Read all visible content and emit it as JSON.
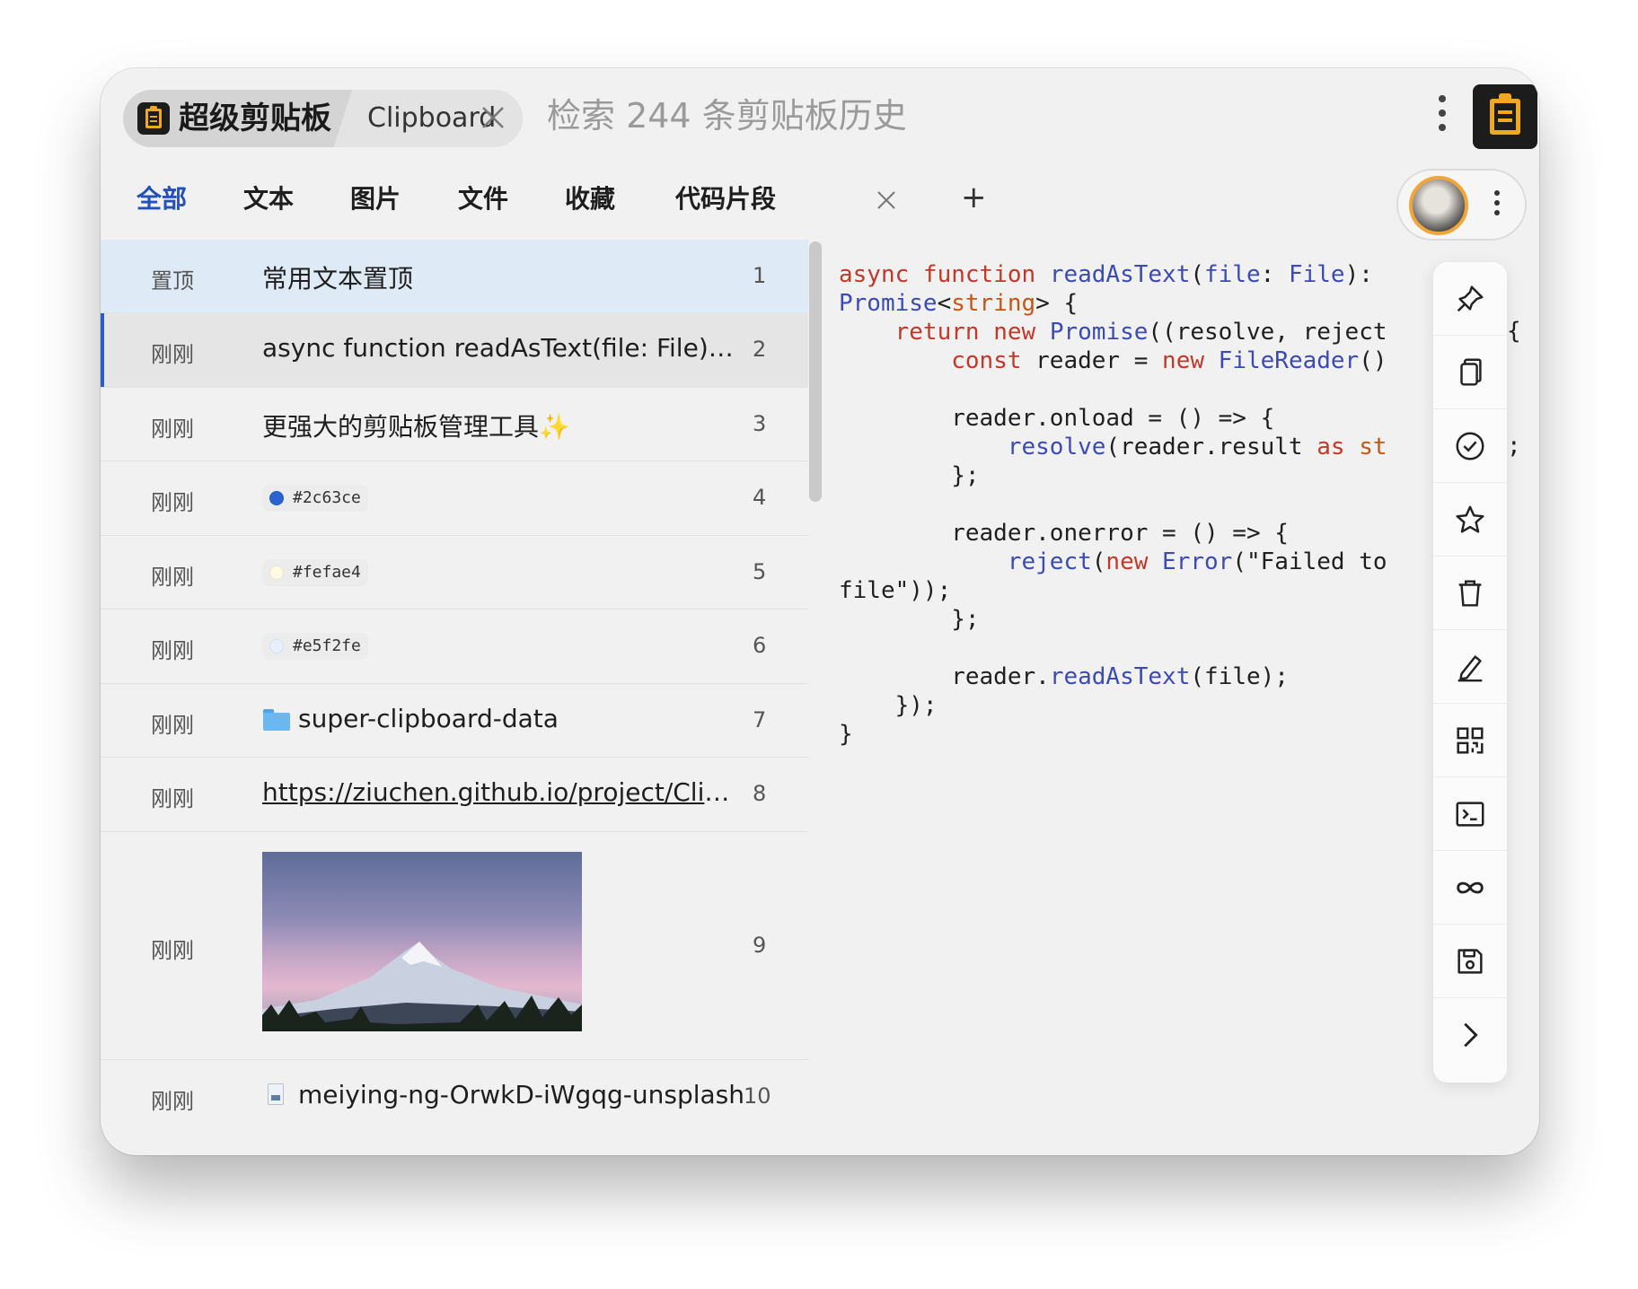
{
  "titlebar": {
    "app_title": "超级剪贴板",
    "second_tab": "Clipboard",
    "search_placeholder": "检索 244 条剪贴板历史"
  },
  "categories": [
    "全部",
    "文本",
    "图片",
    "文件",
    "收藏",
    "代码片段"
  ],
  "category_add": "+",
  "list": [
    {
      "when": "置顶",
      "content": "常用文本置顶",
      "index": "1"
    },
    {
      "when": "刚刚",
      "content": "async function readAsText(file: File): Pr...",
      "index": "2"
    },
    {
      "when": "刚刚",
      "content": "更强大的剪贴板管理工具✨",
      "index": "3"
    },
    {
      "when": "刚刚",
      "content": "#2c63ce",
      "swatch": "#2c63ce",
      "index": "4"
    },
    {
      "when": "刚刚",
      "content": "#fefae4",
      "swatch": "#fefae4",
      "index": "5"
    },
    {
      "when": "刚刚",
      "content": "#e5f2fe",
      "swatch": "#e5f2fe",
      "index": "6"
    },
    {
      "when": "刚刚",
      "content": "super-clipboard-data",
      "index": "7"
    },
    {
      "when": "刚刚",
      "content": "https://ziuchen.github.io/project/Clipbo...",
      "index": "8"
    },
    {
      "when": "刚刚",
      "content": "",
      "index": "9"
    },
    {
      "when": "刚刚",
      "content": "meiying-ng-OrwkD-iWgqg-unsplash.jp",
      "index": "10"
    }
  ],
  "code_lines": [
    [
      [
        "k",
        "async "
      ],
      [
        "k",
        "function "
      ],
      [
        "f",
        "readAsText"
      ],
      [
        "p",
        "("
      ],
      [
        "t",
        "file"
      ],
      [
        "p",
        ": "
      ],
      [
        "t",
        "File"
      ],
      [
        "p",
        "): "
      ]
    ],
    [
      [
        "t",
        "Promise"
      ],
      [
        "p",
        "<"
      ],
      [
        "s",
        "string"
      ],
      [
        "p",
        "> {"
      ]
    ],
    [
      [
        "p",
        "    "
      ],
      [
        "k",
        "return "
      ],
      [
        "k",
        "new "
      ],
      [
        "t",
        "Promise"
      ],
      [
        "p",
        "((resolve, reject"
      ]
    ],
    [
      [
        "p",
        "        "
      ],
      [
        "k",
        "const "
      ],
      [
        "p",
        "reader = "
      ],
      [
        "k",
        "new "
      ],
      [
        "t",
        "FileReader"
      ],
      [
        "p",
        "()"
      ]
    ],
    [
      [
        "p",
        ""
      ]
    ],
    [
      [
        "p",
        "        reader.onload = () => {"
      ]
    ],
    [
      [
        "p",
        "            "
      ],
      [
        "f",
        "resolve"
      ],
      [
        "p",
        "(reader.result "
      ],
      [
        "k",
        "as "
      ],
      [
        "s",
        "st"
      ]
    ],
    [
      [
        "p",
        "        };"
      ]
    ],
    [
      [
        "p",
        ""
      ]
    ],
    [
      [
        "p",
        "        reader.onerror = () => {"
      ]
    ],
    [
      [
        "p",
        "            "
      ],
      [
        "f",
        "reject"
      ],
      [
        "p",
        "("
      ],
      [
        "k",
        "new "
      ],
      [
        "t",
        "Error"
      ],
      [
        "p",
        "(\"Failed to"
      ]
    ],
    [
      [
        "p",
        "file\"));"
      ]
    ],
    [
      [
        "p",
        "        };"
      ]
    ],
    [
      [
        "p",
        ""
      ]
    ],
    [
      [
        "p",
        "        reader."
      ],
      [
        "f",
        "readAsText"
      ],
      [
        "p",
        "(file);"
      ]
    ],
    [
      [
        "p",
        "    });"
      ]
    ],
    [
      [
        "p",
        "}"
      ]
    ]
  ],
  "code_overflow": {
    "brace": "{",
    "semicolon": ";"
  },
  "toolbar": [
    "pin-icon",
    "copy-icon",
    "check-circle-icon",
    "star-icon",
    "trash-icon",
    "edit-icon",
    "qr-code-icon",
    "terminal-icon",
    "infinity-icon",
    "save-icon",
    "chevron-right-icon"
  ],
  "colors": {
    "accent": "#2451b8",
    "brand": "#f0a81c",
    "selected_bar": "#2c5cc5"
  }
}
